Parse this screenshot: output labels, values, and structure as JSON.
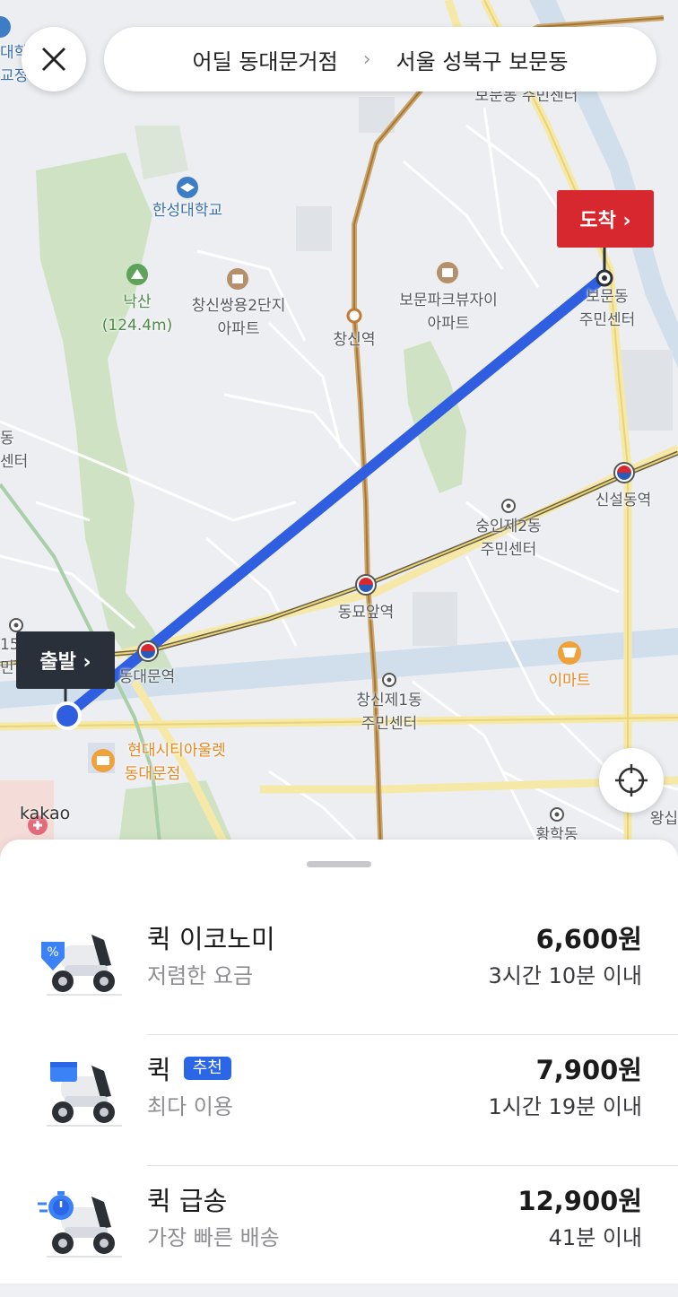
{
  "header": {
    "origin": "어딜 동대문거점",
    "separator": "›",
    "destination": "서울 성북구 보문동"
  },
  "map": {
    "start_label": "출발 ›",
    "end_label": "도착 ›",
    "attribution": "kakao",
    "places": {
      "hansung": "한성대학교",
      "naksan": "낙산",
      "naksan_elev": "(124.4m)",
      "changsin_ssangyong_1": "창신쌍용2단지",
      "changsin_ssangyong_2": "아파트",
      "bomun_park_1": "보문파크뷰자이",
      "bomun_park_2": "아파트",
      "changsin_stn": "창신역",
      "bomun_center_1": "보문동",
      "bomun_center_2": "주민센터",
      "bomun_center_top": "보문동 주민센터",
      "sinseoldong_stn": "신설동역",
      "sungin2_1": "숭인제2동",
      "sungin2_2": "주민센터",
      "dongmyo_stn": "동묘앞역",
      "dongdaemun_stn": "동대문역",
      "emart": "이마트",
      "changsin1_1": "창신제1동",
      "changsin1_2": "주민센터",
      "hyundai_1": "현대시티아울렛",
      "hyundai_2": "동대문점",
      "hwanghak": "황학동",
      "wangsim": "왕십",
      "left_dong": "동",
      "left_center": "센터",
      "left_15": "15",
      "left_min": "민",
      "left_univ": "대학",
      "left_school": "교정"
    }
  },
  "options": [
    {
      "name": "퀵 이코노미",
      "desc": "저렴한 요금",
      "price": "6,600원",
      "eta": "3시간 10분 이내",
      "badge": ""
    },
    {
      "name": "퀵",
      "desc": "최다 이용",
      "price": "7,900원",
      "eta": "1시간 19분 이내",
      "badge": "추천"
    },
    {
      "name": "퀵 급송",
      "desc": "가장 빠른 배송",
      "price": "12,900원",
      "eta": "41분 이내",
      "badge": ""
    }
  ],
  "colors": {
    "route": "#2f5fe0",
    "start_pin": "#29303a",
    "end_pin": "#d7282f",
    "badge": "#2a66e6",
    "park": "#cfe3c4"
  },
  "icons": [
    "close-icon",
    "chevron-right-icon",
    "crosshair-icon",
    "scooter-icon",
    "discount-tag-icon",
    "box-icon",
    "stopwatch-icon"
  ]
}
